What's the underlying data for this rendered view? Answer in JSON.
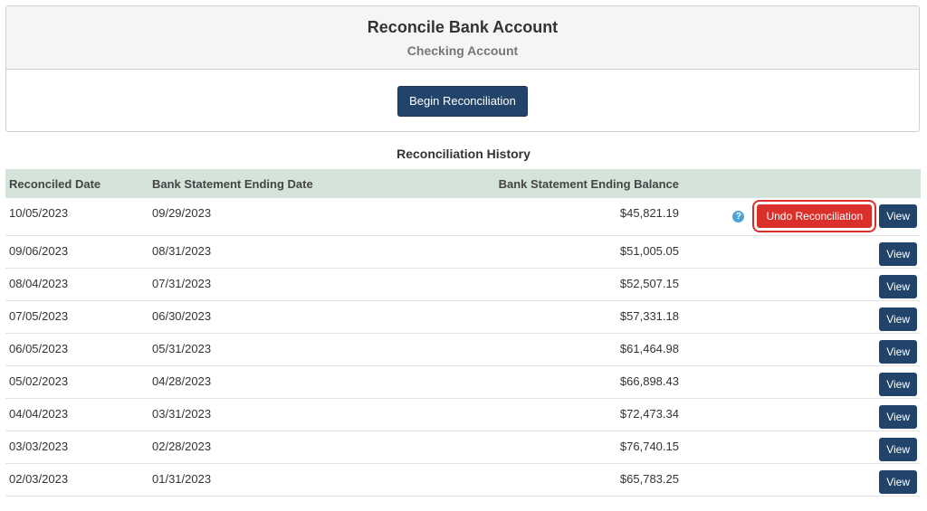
{
  "header": {
    "title": "Reconcile Bank Account",
    "subtitle": "Checking Account",
    "begin_button": "Begin Reconciliation"
  },
  "history": {
    "title": "Reconciliation History",
    "columns": [
      "Reconciled Date",
      "Bank Statement Ending Date",
      "Bank Statement Ending Balance"
    ],
    "undo_label": "Undo Reconciliation",
    "help_icon": "?",
    "view_label": "View",
    "rows": [
      {
        "reconciled": "10/05/2023",
        "ending_date": "09/29/2023",
        "balance": "$45,821.19"
      },
      {
        "reconciled": "09/06/2023",
        "ending_date": "08/31/2023",
        "balance": "$51,005.05"
      },
      {
        "reconciled": "08/04/2023",
        "ending_date": "07/31/2023",
        "balance": "$52,507.15"
      },
      {
        "reconciled": "07/05/2023",
        "ending_date": "06/30/2023",
        "balance": "$57,331.18"
      },
      {
        "reconciled": "06/05/2023",
        "ending_date": "05/31/2023",
        "balance": "$61,464.98"
      },
      {
        "reconciled": "05/02/2023",
        "ending_date": "04/28/2023",
        "balance": "$66,898.43"
      },
      {
        "reconciled": "04/04/2023",
        "ending_date": "03/31/2023",
        "balance": "$72,473.34"
      },
      {
        "reconciled": "03/03/2023",
        "ending_date": "02/28/2023",
        "balance": "$76,740.15"
      },
      {
        "reconciled": "02/03/2023",
        "ending_date": "01/31/2023",
        "balance": "$65,783.25"
      }
    ]
  },
  "colors": {
    "primary": "#22446a",
    "danger": "#d9302b",
    "table_header": "#d4e4da",
    "help": "#4ea3d4"
  }
}
